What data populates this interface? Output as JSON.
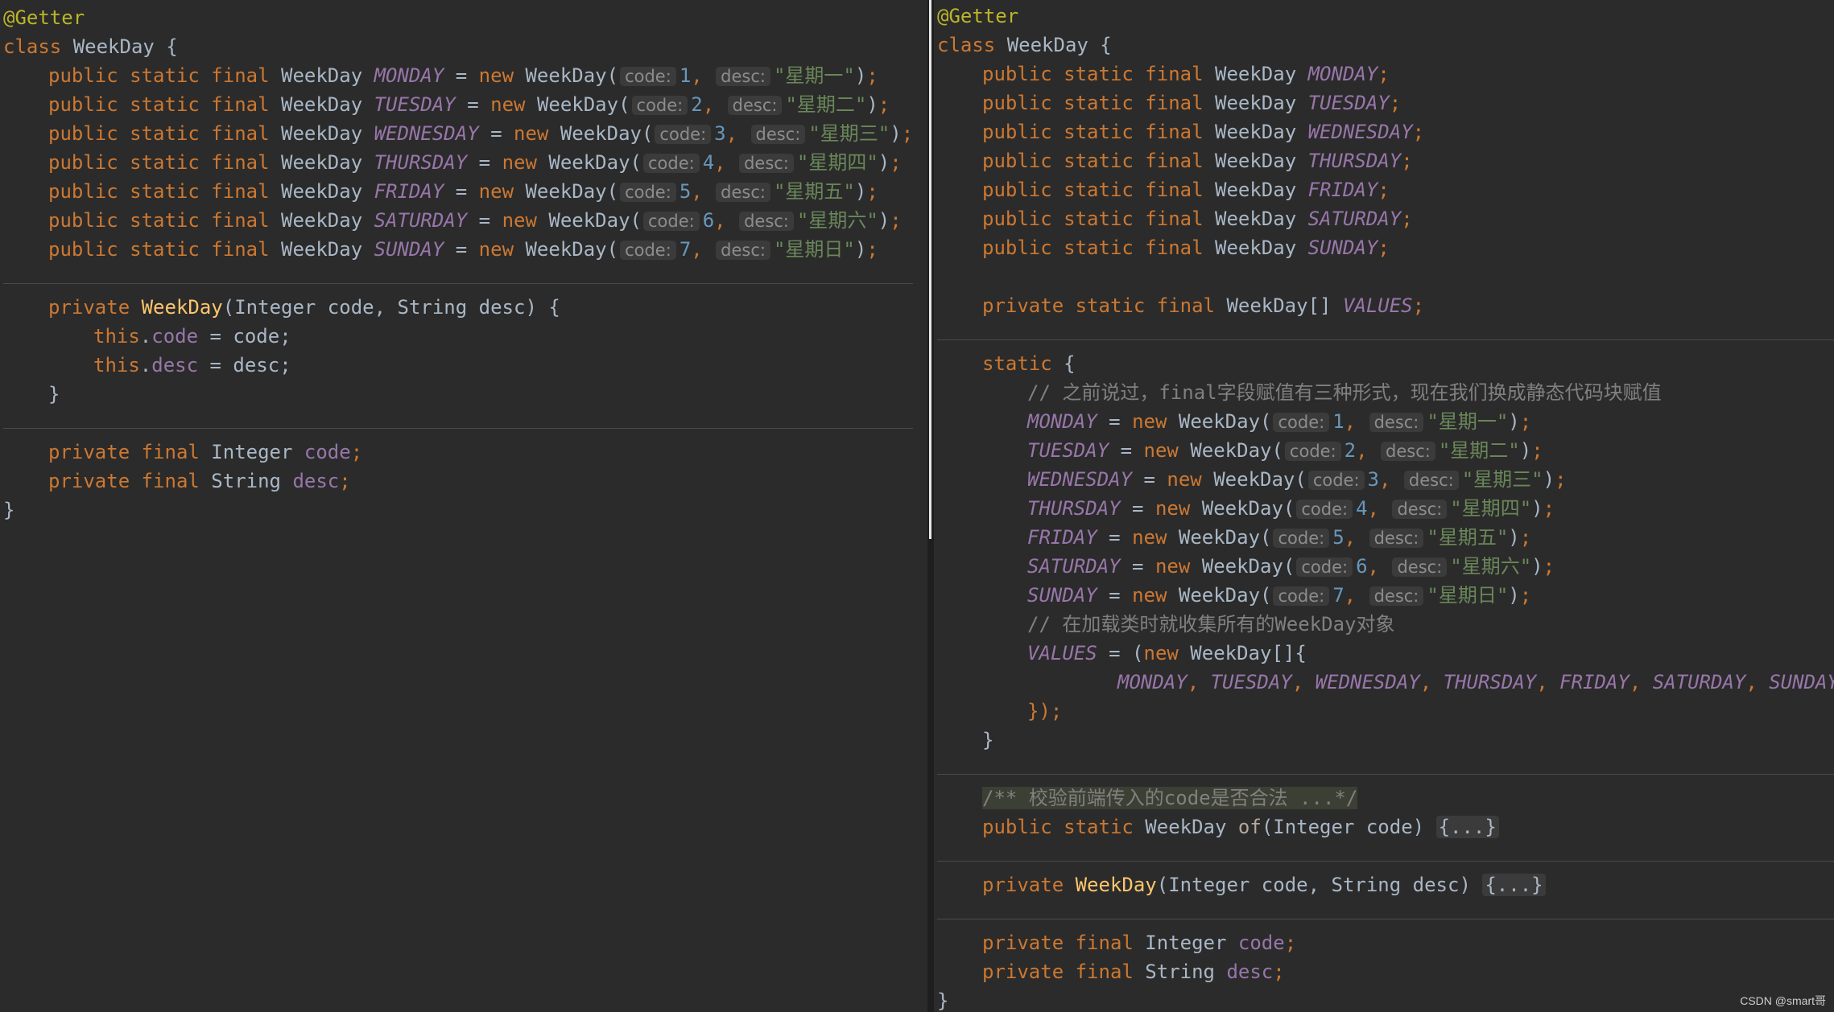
{
  "left": {
    "annotation": "@Getter",
    "class_kw": "class",
    "class_name": "WeekDay",
    "open_brace": " {",
    "mods": "public static final",
    "type": "WeekDay",
    "new_kw": "new",
    "ctor_open": "WeekDay(",
    "code_label": "code:",
    "desc_label": "desc:",
    "days": [
      {
        "name": "MONDAY",
        "code": "1",
        "desc": "\"星期一\""
      },
      {
        "name": "TUESDAY",
        "code": "2",
        "desc": "\"星期二\""
      },
      {
        "name": "WEDNESDAY",
        "code": "3",
        "desc": "\"星期三\""
      },
      {
        "name": "THURSDAY",
        "code": "4",
        "desc": "\"星期四\""
      },
      {
        "name": "FRIDAY",
        "code": "5",
        "desc": "\"星期五\""
      },
      {
        "name": "SATURDAY",
        "code": "6",
        "desc": "\"星期六\""
      },
      {
        "name": "SUNDAY",
        "code": "7",
        "desc": "\"星期日\""
      }
    ],
    "ctor_private": "private",
    "ctor_name": "WeekDay",
    "ctor_params": "(Integer code, String desc) {",
    "this_kw": "this",
    "assign_code_field": "code",
    "assign_code_rest": " = code;",
    "assign_desc_field": "desc",
    "assign_desc_rest": " = desc;",
    "close_brace": "}",
    "field_mods": "private final",
    "field1_type": "Integer",
    "field1_name": "code",
    "field2_type": "String",
    "field2_name": "desc",
    "semicolon": ";"
  },
  "right": {
    "annotation": "@Getter",
    "class_kw": "class",
    "class_name": "WeekDay",
    "mods": "public static final",
    "type": "WeekDay",
    "days": [
      "MONDAY",
      "TUESDAY",
      "WEDNESDAY",
      "THURSDAY",
      "FRIDAY",
      "SATURDAY",
      "SUNDAY"
    ],
    "values_mods": "private static final",
    "values_type": "WeekDay[]",
    "values_name": "VALUES",
    "static_kw": "static",
    "comment1": "// 之前说过，final字段赋值有三种形式，现在我们换成静态代码块赋值",
    "assigns": [
      {
        "name": "MONDAY",
        "code": "1",
        "desc": "\"星期一\""
      },
      {
        "name": "TUESDAY",
        "code": "2",
        "desc": "\"星期二\""
      },
      {
        "name": "WEDNESDAY",
        "code": "3",
        "desc": "\"星期三\""
      },
      {
        "name": "THURSDAY",
        "code": "4",
        "desc": "\"星期四\""
      },
      {
        "name": "FRIDAY",
        "code": "5",
        "desc": "\"星期五\""
      },
      {
        "name": "SATURDAY",
        "code": "6",
        "desc": "\"星期六\""
      },
      {
        "name": "SUNDAY",
        "code": "7",
        "desc": "\"星期日\""
      }
    ],
    "comment2": "// 在加载类时就收集所有的WeekDay对象",
    "values_assign_pre": " = (",
    "new_kw": "new",
    "array_ctor": " WeekDay[]{",
    "values_list": [
      "MONDAY",
      "TUESDAY",
      "WEDNESDAY",
      "THURSDAY",
      "FRIDAY",
      "SATURDAY",
      "SUNDAY"
    ],
    "array_close": "});",
    "doc_comment": "/** 校验前端传入的code是否合法 ...*/",
    "of_mods": "public static",
    "of_type": "WeekDay",
    "of_name": "of",
    "of_params": "(Integer code) ",
    "folded": "{...}",
    "ctor_private": "private",
    "ctor_name": "WeekDay",
    "ctor_params": "(Integer code, String desc) ",
    "field_mods": "private final",
    "field1_type": "Integer",
    "field1_name": "code",
    "field2_type": "String",
    "field2_name": "desc"
  },
  "watermark": "CSDN @smart哥"
}
